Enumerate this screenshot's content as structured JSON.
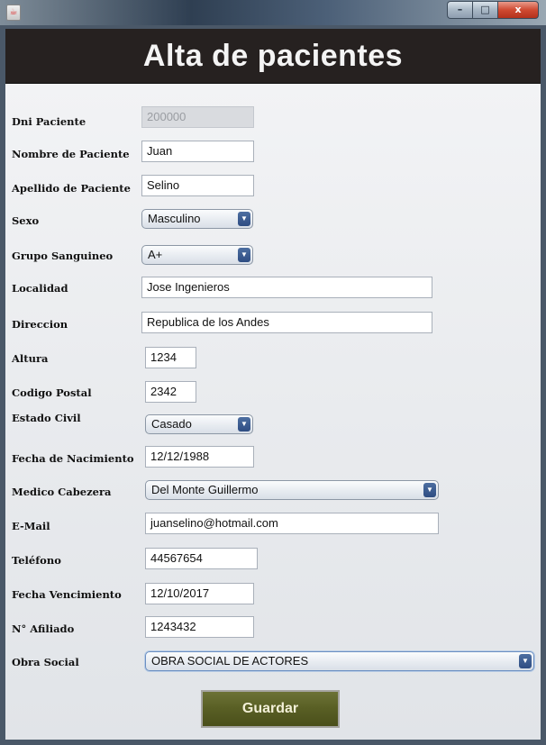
{
  "window": {
    "app_icon": "java-icon",
    "min_glyph": "–",
    "max_glyph": "□",
    "close_glyph": "x"
  },
  "header": {
    "title": "Alta de pacientes"
  },
  "form": {
    "dni": {
      "label": "Dni Paciente",
      "value": "200000"
    },
    "nombre": {
      "label": "Nombre de Paciente",
      "value": "Juan"
    },
    "apellido": {
      "label": "Apellido de Paciente",
      "value": "Selino"
    },
    "sexo": {
      "label": "Sexo",
      "value": "Masculino"
    },
    "grupo": {
      "label": "Grupo Sanguineo",
      "value": "A+"
    },
    "localidad": {
      "label": "Localidad",
      "value": "Jose Ingenieros"
    },
    "direccion": {
      "label": "Direccion",
      "value": "Republica de los Andes"
    },
    "altura": {
      "label": "Altura",
      "value": "1234"
    },
    "codigo_postal": {
      "label": "Codigo Postal",
      "value": "2342"
    },
    "estado_civil": {
      "label": "Estado Civil",
      "value": "Casado"
    },
    "fecha_nacimiento": {
      "label": "Fecha de Nacimiento",
      "value": "12/12/1988"
    },
    "medico": {
      "label": "Medico Cabezera",
      "value": "Del Monte Guillermo"
    },
    "email": {
      "label": "E-Mail",
      "value": "juanselino@hotmail.com"
    },
    "telefono": {
      "label": "Teléfono",
      "value": "44567654"
    },
    "fecha_vencimiento": {
      "label": "Fecha Vencimiento",
      "value": "12/10/2017"
    },
    "afiliado": {
      "label": "N° Afiliado",
      "value": "1243432"
    },
    "obra_social": {
      "label": "Obra Social",
      "value": "OBRA SOCIAL DE ACTORES"
    }
  },
  "actions": {
    "save_label": "Guardar"
  },
  "arrow_glyph": "▼"
}
